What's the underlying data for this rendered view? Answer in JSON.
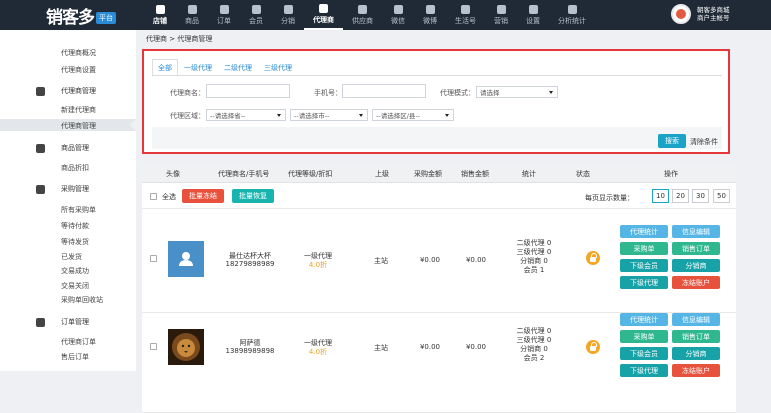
{
  "topbar": {
    "brand": "销客多",
    "brand_tag": "平台",
    "nav": [
      "店铺",
      "商品",
      "订单",
      "会员",
      "分销",
      "代理商",
      "供应商",
      "微信",
      "微博",
      "生活号",
      "营销",
      "设置",
      "分析统计"
    ],
    "active_nav": "代理商",
    "user_line1": "朝客多商城",
    "user_line2": "商户主帐号"
  },
  "sidebar": {
    "agent": [
      "代理商概况",
      "代理商设置"
    ],
    "agent_group": "代理商管理",
    "agent_items": [
      "新建代理商",
      "代理商管理"
    ],
    "goods_group": "商品管理",
    "goods_items": [
      "商品折扣"
    ],
    "purchase_group": "采购管理",
    "purchase_items": [
      "所有采购单",
      "等待付款",
      "等待发货",
      "已发货",
      "交易成功",
      "交易关闭",
      "采购单回收站"
    ],
    "order_group": "订单管理",
    "order_items": [
      "代理商订单",
      "售后订单"
    ]
  },
  "breadcrumb": "代理商 > 代理商管理",
  "filter": {
    "tabs": [
      "全部",
      "一级代理",
      "二级代理",
      "三级代理"
    ],
    "agent_label": "代理商名：",
    "phone_label": "手机号：",
    "mode_label": "代理模式：",
    "mode_placeholder": "请选择",
    "region_label": "代理区域：",
    "province_placeholder": "--请选择省--",
    "city_placeholder": "--请选择市--",
    "district_placeholder": "--请选择区/县--",
    "search_button": "搜索",
    "clear_link": "清除条件"
  },
  "table": {
    "headers": [
      "头像",
      "代理商名/手机号",
      "代理等级/折扣",
      "上级",
      "采购金额",
      "销售金额",
      "统计",
      "状态",
      "操作"
    ],
    "select_all": "全选",
    "batch_freeze": "批量冻结",
    "batch_restore": "批量恢复",
    "per_page_label": "每页显示数量：",
    "per_page_options": [
      "10",
      "20",
      "30",
      "50"
    ],
    "per_page_selected": "10",
    "rows": [
      {
        "name": "最仕达杯大杯",
        "phone": "18279898989",
        "level": "一级代理",
        "discount": "4.0折",
        "parent": "主站",
        "purchase": "¥0.00",
        "sales": "¥0.00",
        "stats": [
          "二级代理 0",
          "三级代理 0",
          "分销商 0",
          "会员 1"
        ],
        "avatar": "default"
      },
      {
        "name": "阿萨德",
        "phone": "13898989898",
        "level": "一级代理",
        "discount": "4.0折",
        "parent": "主站",
        "purchase": "¥0.00",
        "sales": "¥0.00",
        "stats": [
          "二级代理 0",
          "三级代理 0",
          "分销商 0",
          "会员 2"
        ],
        "avatar": "lion"
      }
    ],
    "row_actions": [
      "代理统计",
      "信息编辑",
      "采购单",
      "销售订单",
      "下级会员",
      "分销商",
      "下级代理",
      "冻结账户"
    ]
  },
  "colors": {
    "topbar": "#1f2a36",
    "highlight": "#e5373a",
    "search": "#1aa3c7",
    "danger": "#e8513c",
    "teal": "#18b5b0",
    "discount": "#f0a220"
  }
}
